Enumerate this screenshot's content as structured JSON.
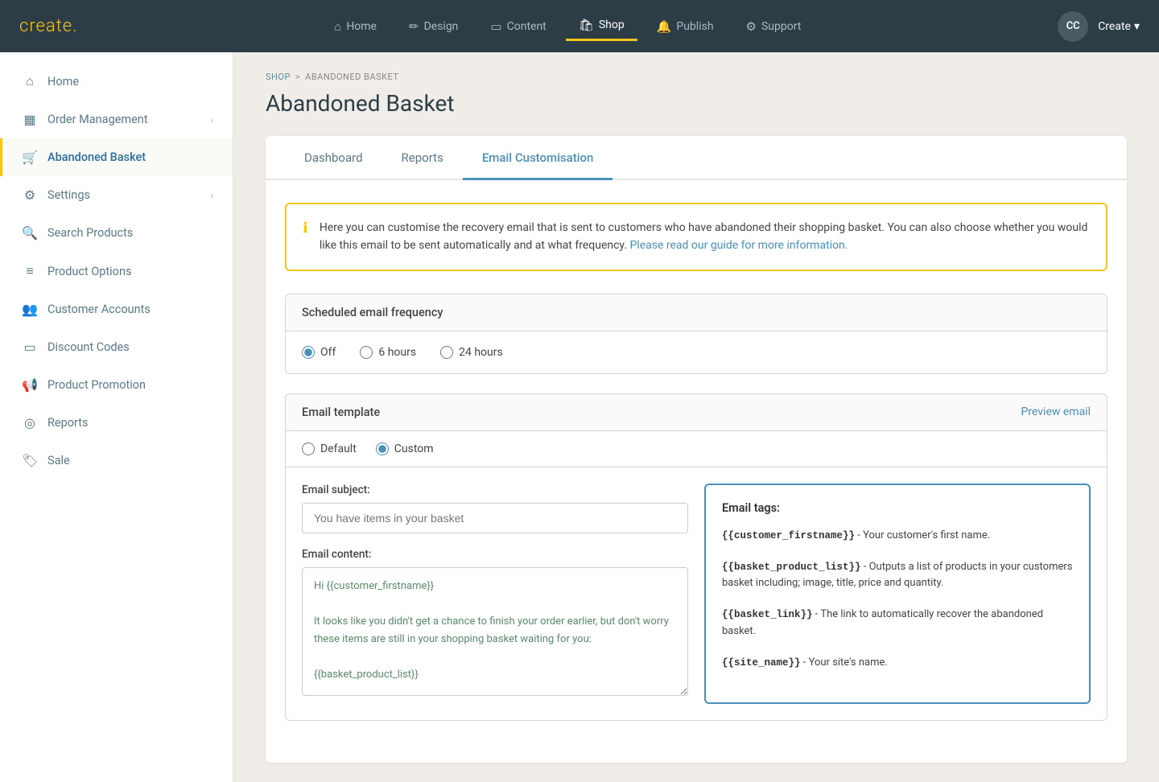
{
  "logo": {
    "text": "create",
    "dot": "."
  },
  "topNav": {
    "links": [
      {
        "id": "home",
        "label": "Home",
        "icon": "⌂",
        "active": false
      },
      {
        "id": "design",
        "label": "Design",
        "icon": "✏",
        "active": false
      },
      {
        "id": "content",
        "label": "Content",
        "icon": "▭",
        "active": false
      },
      {
        "id": "shop",
        "label": "Shop",
        "icon": "🛍",
        "active": true
      },
      {
        "id": "publish",
        "label": "Publish",
        "icon": "🔔",
        "active": false
      },
      {
        "id": "support",
        "label": "Support",
        "icon": "⚙",
        "active": false
      }
    ],
    "avatar": "CC",
    "create_label": "Create"
  },
  "breadcrumb": {
    "shop": "SHOP",
    "separator": ">",
    "current": "ABANDONED BASKET"
  },
  "pageTitle": "Abandoned Basket",
  "sidebar": {
    "items": [
      {
        "id": "home",
        "label": "Home",
        "icon": "⌂",
        "active": false,
        "arrow": false
      },
      {
        "id": "order-management",
        "label": "Order Management",
        "icon": "▦",
        "active": false,
        "arrow": true
      },
      {
        "id": "abandoned-basket",
        "label": "Abandoned Basket",
        "icon": "🛒",
        "active": true,
        "arrow": false
      },
      {
        "id": "settings",
        "label": "Settings",
        "icon": "⚙",
        "active": false,
        "arrow": true
      },
      {
        "id": "search-products",
        "label": "Search Products",
        "icon": "🔍",
        "active": false,
        "arrow": false
      },
      {
        "id": "product-options",
        "label": "Product Options",
        "icon": "≡",
        "active": false,
        "arrow": false
      },
      {
        "id": "customer-accounts",
        "label": "Customer Accounts",
        "icon": "👥",
        "active": false,
        "arrow": false
      },
      {
        "id": "discount-codes",
        "label": "Discount Codes",
        "icon": "▭",
        "active": false,
        "arrow": false
      },
      {
        "id": "product-promotion",
        "label": "Product Promotion",
        "icon": "📢",
        "active": false,
        "arrow": false
      },
      {
        "id": "reports",
        "label": "Reports",
        "icon": "◎",
        "active": false,
        "arrow": false
      },
      {
        "id": "sale",
        "label": "Sale",
        "icon": "🏷",
        "active": false,
        "arrow": false
      }
    ]
  },
  "tabs": [
    {
      "id": "dashboard",
      "label": "Dashboard",
      "active": false
    },
    {
      "id": "reports",
      "label": "Reports",
      "active": false
    },
    {
      "id": "email-customisation",
      "label": "Email Customisation",
      "active": true
    }
  ],
  "infoBox": {
    "text": "Here you can customise the recovery email that is sent to customers who have abandoned their shopping basket. You can also choose whether you would like this email to be sent automatically and at what frequency.",
    "linkText": "Please read our guide for more information.",
    "linkUrl": "#"
  },
  "scheduledFrequency": {
    "title": "Scheduled email frequency",
    "options": [
      {
        "id": "off",
        "label": "Off",
        "checked": true
      },
      {
        "id": "6hours",
        "label": "6 hours",
        "checked": false
      },
      {
        "id": "24hours",
        "label": "24 hours",
        "checked": false
      }
    ]
  },
  "emailTemplate": {
    "title": "Email template",
    "previewLabel": "Preview email",
    "templateOptions": [
      {
        "id": "default",
        "label": "Default",
        "checked": false
      },
      {
        "id": "custom",
        "label": "Custom",
        "checked": true
      }
    ],
    "subjectLabel": "Email subject:",
    "subjectPlaceholder": "You have items in your basket",
    "contentLabel": "Email content:",
    "contentText": "Hi {{customer_firstname}}\n\nIt looks like you didn't get a chance to finish your order earlier, but don't worry these items are still in your shopping basket waiting for you:\n\n{{basket_product_list}}"
  },
  "emailTags": {
    "title": "Email tags:",
    "tags": [
      {
        "code": "{{customer_firstname}}",
        "description": " - Your customer's first name."
      },
      {
        "code": "{{basket_product_list}}",
        "description": " - Outputs a list of products in your customers basket including; image, title, price and quantity."
      },
      {
        "code": "{{basket_link}}",
        "description": " - The link to automatically recover the abandoned basket."
      },
      {
        "code": "{{site_name}}",
        "description": " - Your site's name."
      }
    ]
  }
}
